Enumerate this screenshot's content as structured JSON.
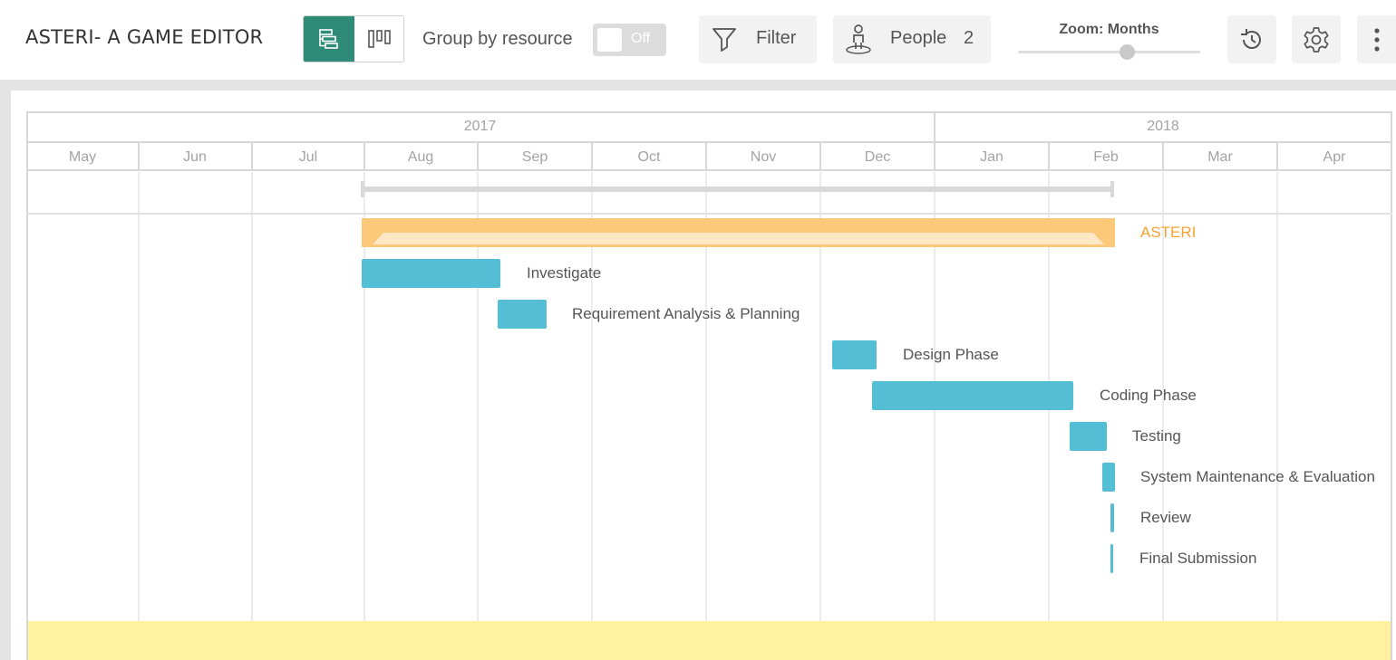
{
  "header": {
    "project_title": "ASTERI- A GAME EDITOR",
    "view_modes": [
      "gantt-view",
      "board-view"
    ],
    "active_view": "gantt-view",
    "group_by_label": "Group by resource",
    "group_by_state": "Off",
    "filter_label": "Filter",
    "people_label": "People",
    "people_count": "2",
    "zoom_label": "Zoom: Months",
    "zoom_level": 0.6
  },
  "timeline": {
    "years": [
      "2017",
      "2018"
    ],
    "months": [
      "May",
      "Jun",
      "Jul",
      "Aug",
      "Sep",
      "Oct",
      "Nov",
      "Dec",
      "Jan",
      "Feb",
      "Mar",
      "Apr"
    ]
  },
  "project": {
    "name": "ASTERI",
    "color": "#fcc87a",
    "label_color": "#f5a332"
  },
  "tasks": [
    {
      "name": "Investigate"
    },
    {
      "name": "Requirement Analysis & Planning"
    },
    {
      "name": "Design Phase"
    },
    {
      "name": "Coding Phase"
    },
    {
      "name": "Testing"
    },
    {
      "name": "System Maintenance & Evaluation"
    },
    {
      "name": "Review"
    },
    {
      "name": "Final Submission"
    }
  ],
  "colors": {
    "accent": "#2e8b78",
    "task_bar": "#53bed4",
    "today_band": "#fff1a0"
  }
}
